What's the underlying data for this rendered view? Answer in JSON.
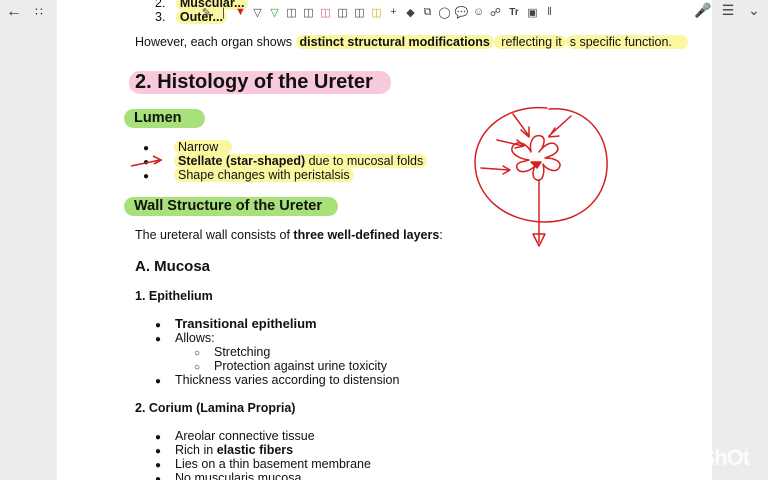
{
  "toolbar": {
    "tools": [
      "pen-icon",
      "eraser-tip-icon",
      "pen-red-icon",
      "pen-icon",
      "highlighter-green-icon",
      "highlighter-icon",
      "highlighter-icon",
      "highlighter-pink-icon",
      "highlighter-icon",
      "highlighter-icon",
      "highlighter-yellow-icon",
      "plus-icon",
      "eraser-icon",
      "shapes-icon",
      "lasso-icon",
      "comment-icon",
      "sticker-icon",
      "link-icon",
      "text-icon",
      "image-icon",
      "more-icon"
    ],
    "text_tool_label": "Tr"
  },
  "top_list": [
    {
      "num": "2.",
      "text": "Muscular..."
    },
    {
      "num": "3.",
      "text": "Outer..."
    }
  ],
  "intro": {
    "before": "However, each organ shows ",
    "bold": "distinct structural modifications",
    "middle": " reflecting it",
    "end": "s specific function."
  },
  "section2_title": "2. Histology of the Ureter",
  "lumen": {
    "heading": "Lumen",
    "items": [
      {
        "bold": "",
        "text": "Narrow"
      },
      {
        "bold": "Stellate (star-shaped)",
        "text": " due to mucosal folds"
      },
      {
        "bold": "",
        "text": "Shape changes with peristalsis"
      }
    ]
  },
  "wall": {
    "heading": "Wall Structure of the Ureter",
    "desc_before": "The ureteral wall consists of ",
    "desc_bold": "three well-defined layers",
    "desc_after": ":"
  },
  "mucosa": {
    "heading": "A. Mucosa",
    "epithelium": {
      "heading": "1. Epithelium",
      "type": "Transitional epithelium",
      "allows": "Allows:",
      "sub": [
        "Stretching",
        "Protection against urine toxicity"
      ],
      "thickness": "Thickness varies according to distension"
    },
    "corium": {
      "heading": "2. Corium (Lamina Propria)",
      "items": [
        {
          "text": "Areolar connective tissue",
          "bold": ""
        },
        {
          "text": "Rich in ",
          "bold": "elastic fibers"
        },
        {
          "text": "Lies on a thin basement membrane",
          "bold": ""
        },
        {
          "text": "No muscularis mucosa",
          "bold": ""
        }
      ]
    }
  },
  "watermark": "InShOt",
  "colors": {
    "highlight_yellow": "#fbf7a0",
    "highlight_pink": "#f8c9dc",
    "highlight_green": "#a8e07a",
    "ink_red": "#d42020"
  }
}
